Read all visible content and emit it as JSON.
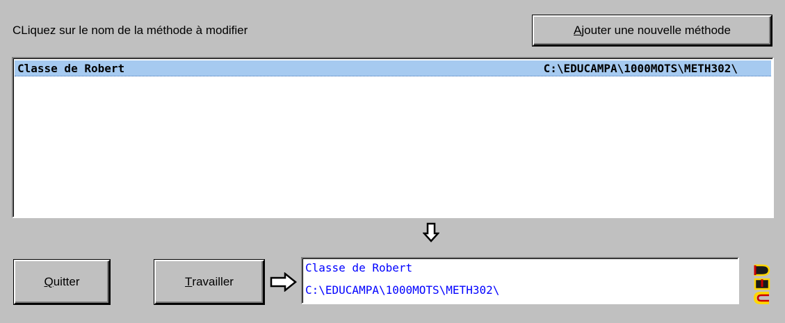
{
  "instruction": "CLiquez sur le nom de la méthode à modifier",
  "buttons": {
    "add_method": {
      "accel": "A",
      "rest": "jouter une nouvelle méthode"
    },
    "quit": {
      "accel": "Q",
      "rest": "uitter"
    },
    "work": {
      "accel": "T",
      "rest": "ravailler"
    }
  },
  "methods_list": [
    {
      "name": "Classe de Robert",
      "path": "C:\\EDUCAMPA\\1000MOTS\\METH302\\",
      "selected": true
    }
  ],
  "selection": {
    "name": "Classe de Robert",
    "path": "C:\\EDUCAMPA\\1000MOTS\\METH302\\"
  },
  "logo": {
    "text": "DMC"
  },
  "colors": {
    "background": "#c0c0c0",
    "selection_highlight": "#a6caf0",
    "info_text": "#0000ff"
  },
  "icons": [
    "down-arrow-icon",
    "right-arrow-icon",
    "dmc-logo"
  ]
}
